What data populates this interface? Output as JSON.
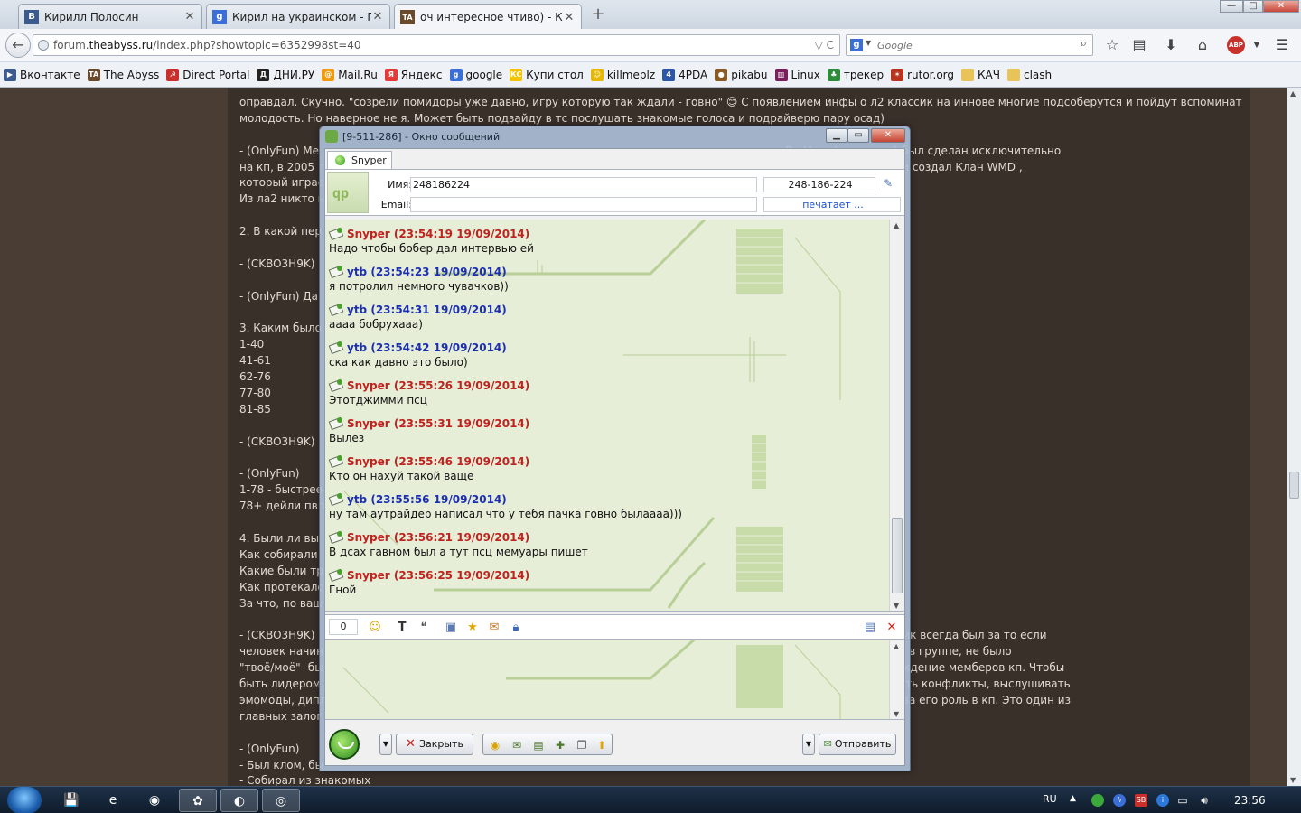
{
  "browser": {
    "tabs": [
      {
        "label": "Кирилл Полосин",
        "active": false,
        "favicon_color": "#3b5b8f",
        "favicon_text": "В"
      },
      {
        "label": "Кирил на украинском - Поис...",
        "active": false,
        "favicon_color": "#3b6fd8",
        "favicon_text": "g"
      },
      {
        "label": "оч интересное чтиво) - Кон...",
        "active": true,
        "favicon_color": "#6b4a2c",
        "favicon_text": "TA"
      }
    ],
    "new_tab": "+",
    "window_buttons": {
      "minimize": "—",
      "maximize": "□",
      "close": "✕"
    },
    "url": {
      "pre": "forum.",
      "domain": "theabyss.ru",
      "post": "/index.php?showtopic=6352998st=40",
      "controls": "▽ C"
    },
    "search": {
      "placeholder": "Google",
      "engine_letter": "g"
    },
    "toolbar_icons": [
      "star-icon",
      "reading-list-icon",
      "download-icon",
      "home-icon",
      "adblock-icon",
      "menu-icon"
    ],
    "abp_label": "ABP",
    "bookmarks": [
      {
        "label": "Вконтакте",
        "color": "#3b5b8f",
        "glyph": "▶"
      },
      {
        "label": "The Abyss",
        "color": "#6b4a2c",
        "glyph": "TA"
      },
      {
        "label": "Direct Portal",
        "color": "#c9302c",
        "glyph": "☭"
      },
      {
        "label": "ДНИ.РУ",
        "color": "#222222",
        "glyph": "Д"
      },
      {
        "label": "Mail.Ru",
        "color": "#f29a0e",
        "glyph": "@"
      },
      {
        "label": "Яндекс",
        "color": "#e53935",
        "glyph": "Я"
      },
      {
        "label": "google",
        "color": "#3b6fd8",
        "glyph": "g"
      },
      {
        "label": "Купи стол",
        "color": "#f5c400",
        "glyph": "КС"
      },
      {
        "label": "killmeplz",
        "color": "#e6b800",
        "glyph": "☺"
      },
      {
        "label": "4PDA",
        "color": "#2b57a7",
        "glyph": "4"
      },
      {
        "label": "pikabu",
        "color": "#8a5a22",
        "glyph": "●"
      },
      {
        "label": "Linux",
        "color": "#7a1f5c",
        "glyph": "▥"
      },
      {
        "label": "трекер",
        "color": "#2e8b3a",
        "glyph": "♣"
      },
      {
        "label": "rutor.org",
        "color": "#b8341e",
        "glyph": "✶"
      },
      {
        "label": "КАЧ",
        "color": "#e8c35a",
        "glyph": ""
      },
      {
        "label": "clash",
        "color": "#e8c35a",
        "glyph": ""
      }
    ]
  },
  "page": {
    "lines": [
      "оправдал. Скучно. \"созрели помидоры уже давно, игру которую так ждали - говно\" 😊 С появлением инфы о л2 классик на иннове многие подсоберутся и пойдут вспоминать",
      "молодость. Но наверное не я. Может быть подзайду в тс послушать знакомые голоса и подрайверю пару осад)",
      "",
      "- (OnlyFun) Ме                                                                                                                  создан клан BadAngels, который был сделан исключительно",
      "на кп, в 2005 г                                                                                                                 был Kumho ), я пересобрал клан и создал Клан WMD ,",
      "который играе",
      "Из ла2 никто н",
      "",
      "2. В какой пер",
      "",
      "- (CKBO3H9K)                                                                                                                    т память с с3 или с4.",
      "",
      "- (OnlyFun) Да",
      "",
      "3. Каким было",
      "1-40",
      "41-61",
      "62-76",
      "77-80",
      "81-85",
      "",
      "- (CKBO3H9K)",
      "",
      "- (OnlyFun)",
      "1-78 - быстрее",
      "78+ дейли пвп",
      "",
      "4. Были ли вы",
      "Как собирали",
      "Какие были тр",
      "Как протекало",
      "За что, по ваш",
      "",
      "- (CKBO3H9K)                                                                                                                    альной составляющей группы. Кик всегда был за то если",
      "человек начин                                                                                                                   и везде был полный акк шаринг в группе, не было",
      "\"твоё/моё\"- бы                                                                                                                 ились в основном на общее обсуждение мемберов кп. Чтобы",
      "быть лидером                                                                                                                    и делал то, что нужно, улаживать конфликты, выслушивать",
      "эмомоды, дипл                                                                                                                   но знать зачем он здесь и какова его роль в кп. Это один из",
      "главных залог",
      "",
      "- (OnlyFun)",
      "- Был клом, бы",
      "- Собирал из знакомых"
    ]
  },
  "messenger": {
    "title": "[9-511-286] - Окно сообщений",
    "window_buttons": {
      "minimize": "▁",
      "maximize": "▭",
      "close": "✕"
    },
    "contact_tab": "Snyper",
    "avatar_text": "qp",
    "name_label": "Имя:",
    "name_value": "248186224",
    "uin_value": "248-186-224",
    "email_label": "Email:",
    "email_value": "",
    "typing_status": "печатает ...",
    "messages": [
      {
        "author": "Snyper",
        "time": "(23:54:19 19/09/2014)",
        "text": "Надо чтобы бобер дал интервью ей",
        "side": "them"
      },
      {
        "author": "ytb",
        "time": "(23:54:23 19/09/2014)",
        "text": "я потролил немного чувачков))",
        "side": "me"
      },
      {
        "author": "ytb",
        "time": "(23:54:31 19/09/2014)",
        "text": "аааа бобрухааа)",
        "side": "me"
      },
      {
        "author": "ytb",
        "time": "(23:54:42 19/09/2014)",
        "text": "ска как давно это было)",
        "side": "me"
      },
      {
        "author": "Snyper",
        "time": "(23:55:26 19/09/2014)",
        "text": "Этотджимми псц",
        "side": "them"
      },
      {
        "author": "Snyper",
        "time": "(23:55:31 19/09/2014)",
        "text": "Вылез",
        "side": "them"
      },
      {
        "author": "Snyper",
        "time": "(23:55:46 19/09/2014)",
        "text": "Кто он нахуй такой ваще",
        "side": "them"
      },
      {
        "author": "ytb",
        "time": "(23:55:56 19/09/2014)",
        "text": "ну там аутрайдер написал что у тебя пачка говно былаааа)))",
        "side": "me"
      },
      {
        "author": "Snyper",
        "time": "(23:56:21 19/09/2014)",
        "text": "В дсах гавном был а тут псц мемуары пишет",
        "side": "them"
      },
      {
        "author": "Snyper",
        "time": "(23:56:25 19/09/2014)",
        "text": "Гной",
        "side": "them"
      }
    ],
    "char_count": "0",
    "input_value": "",
    "close_label": "Закрыть",
    "send_label": "Отправить"
  },
  "taskbar": {
    "apps": [
      {
        "name": "taskbar-app-storage",
        "glyph": "💾",
        "active": false
      },
      {
        "name": "taskbar-app-ie",
        "glyph": "e",
        "active": false
      },
      {
        "name": "taskbar-app-chrome",
        "glyph": "◉",
        "active": false
      },
      {
        "name": "taskbar-app-qip",
        "glyph": "✿",
        "active": true
      },
      {
        "name": "taskbar-app-firefox",
        "glyph": "◐",
        "active": true
      },
      {
        "name": "taskbar-app-player",
        "glyph": "◎",
        "active": true
      }
    ],
    "lang": "RU",
    "clock": "23:56"
  }
}
